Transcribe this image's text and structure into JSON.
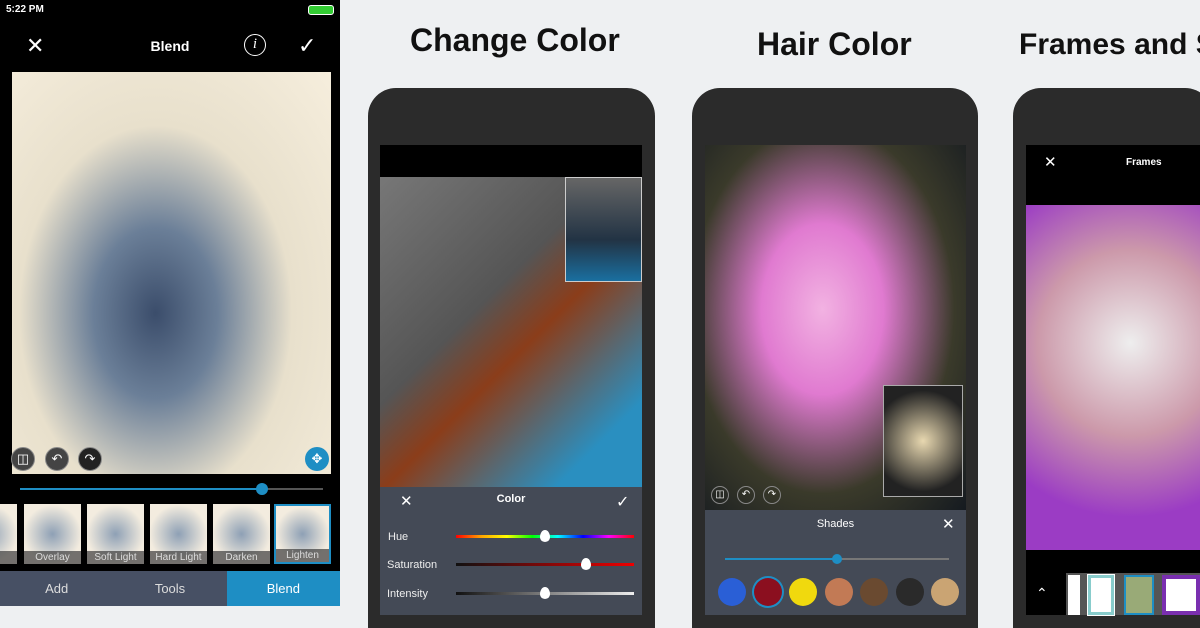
{
  "blend_screen": {
    "status_time": "5:22 PM",
    "title": "Blend",
    "icons": [
      "close-icon",
      "info-icon",
      "check-icon",
      "compare-icon",
      "undo-icon",
      "redo-icon",
      "move-icon"
    ],
    "slider_value": 0.8,
    "blend_modes": [
      "n",
      "Overlay",
      "Soft Light",
      "Hard Light",
      "Darken",
      "Lighten"
    ],
    "selected_mode": "Lighten",
    "tabs": [
      "Add",
      "Tools",
      "Blend"
    ],
    "active_tab": "Blend",
    "accent": "#1e8ec4"
  },
  "change_color": {
    "heading": "Change Color",
    "panel_title": "Color",
    "sliders": [
      {
        "label": "Hue",
        "value": 0.5
      },
      {
        "label": "Saturation",
        "value": 0.73
      },
      {
        "label": "Intensity",
        "value": 0.5
      }
    ]
  },
  "hair_color": {
    "heading": "Hair Color",
    "panel_title": "Shades",
    "slider_value": 0.5,
    "swatches": [
      "#2a5fd6",
      "#8b0f1f",
      "#f0d90e",
      "#c27a55",
      "#6a4a30",
      "#2a2a2a",
      "#caa473"
    ],
    "selected_swatch": 1
  },
  "frames": {
    "heading": "Frames and S",
    "screen_title": "Frames"
  }
}
